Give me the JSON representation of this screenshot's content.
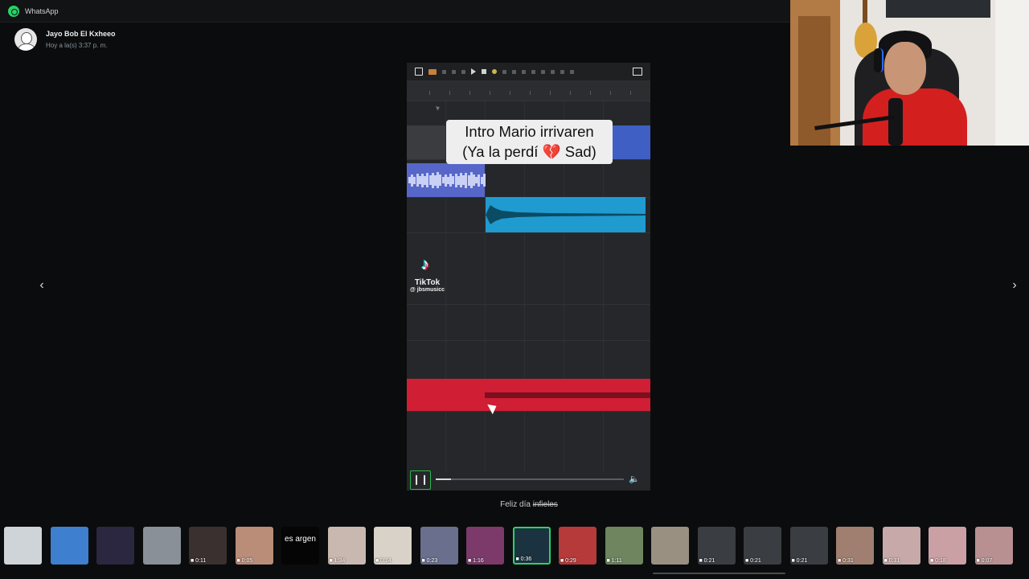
{
  "app": {
    "title": "WhatsApp"
  },
  "sender": {
    "name": "Jayo Bob El Kxheeo",
    "time": "Hoy a la(s) 3:37 p. m."
  },
  "navigation": {
    "prev_icon": "chevron-left-icon",
    "next_icon": "chevron-right-icon"
  },
  "video": {
    "overlay_caption_line1": "Intro Mario irrivaren",
    "overlay_caption_line2": "(Ya la perdí 💔 Sad)",
    "watermark_brand": "TikTok",
    "watermark_user": "@ jbsmusicc",
    "playing": true,
    "progress_fraction": 0.08
  },
  "message": {
    "caption_prefix": "Feliz día ",
    "caption_strike": "infieles"
  },
  "thumbnails": [
    {
      "duration": "",
      "color": "#cfd4d8"
    },
    {
      "duration": "",
      "color": "#3e7fd0"
    },
    {
      "duration": "",
      "color": "#2b2740"
    },
    {
      "duration": "",
      "color": "#8a9098"
    },
    {
      "duration": "0:11",
      "color": "#3a3030"
    },
    {
      "duration": "0:05",
      "color": "#b98d78"
    },
    {
      "duration": "",
      "text": "es argen",
      "color": "#050505"
    },
    {
      "duration": "1:34",
      "color": "#c9b8b0"
    },
    {
      "duration": "0:14",
      "color": "#d8d2c8"
    },
    {
      "duration": "0:23",
      "color": "#6b6f8e"
    },
    {
      "duration": "1:16",
      "color": "#7b3a6a"
    },
    {
      "duration": "0:36",
      "color": "#1b3340",
      "selected": true
    },
    {
      "duration": "0:29",
      "color": "#b63a3a"
    },
    {
      "duration": "1:11",
      "color": "#6e8560"
    },
    {
      "duration": "",
      "color": "#9a9082"
    },
    {
      "duration": "0:21",
      "color": "#3a3d42"
    },
    {
      "duration": "0:21",
      "color": "#3a3d42"
    },
    {
      "duration": "0:21",
      "color": "#3a3d42"
    },
    {
      "duration": "0:31",
      "color": "#a07f70"
    },
    {
      "duration": "0:31",
      "color": "#c7a9aa"
    },
    {
      "duration": "0:18",
      "color": "#caa0a4"
    },
    {
      "duration": "0:07",
      "color": "#b89092"
    }
  ],
  "colors": {
    "accent": "#2bd368",
    "background": "#0b0c0d"
  }
}
